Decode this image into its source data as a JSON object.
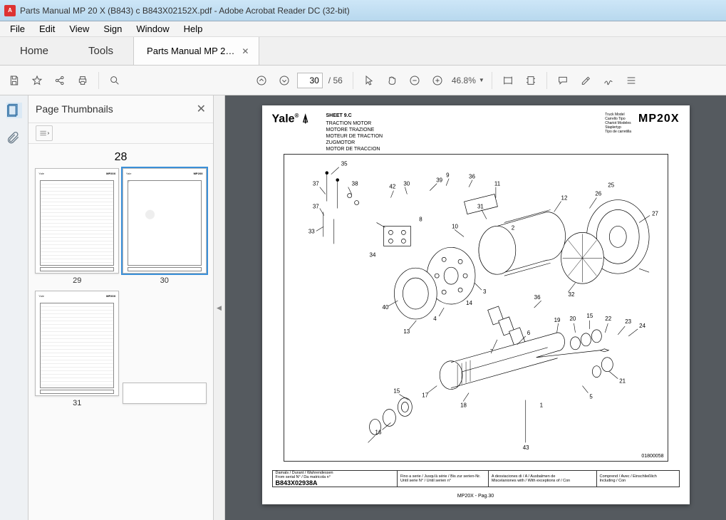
{
  "window": {
    "title": "Parts Manual MP 20 X (B843) c B843X02152X.pdf - Adobe Acrobat Reader DC (32-bit)"
  },
  "menu": {
    "file": "File",
    "edit": "Edit",
    "view": "View",
    "sign": "Sign",
    "window": "Window",
    "help": "Help"
  },
  "tabs": {
    "home": "Home",
    "tools": "Tools",
    "doc": "Parts Manual MP 2…"
  },
  "toolbar": {
    "page_current": "30",
    "page_sep": "/",
    "page_total": "56",
    "zoom": "46.8%"
  },
  "thumbnails": {
    "title": "Page Thumbnails",
    "pages": [
      "28",
      "29",
      "30",
      "31"
    ],
    "selected": "30"
  },
  "sheet": {
    "logo": "Yale",
    "sheet_no": "SHEET 9.C",
    "titles": [
      "TRACTION MOTOR",
      "MOTORE TRAZIONE",
      "MOTEUR DE TRACTION",
      "ZUGMOTOR",
      "MOTOR DE TRACCION"
    ],
    "truck_labels": [
      "Truck Model",
      "Carrello Tipo",
      "Chariot Modeles",
      "Staplertyp",
      "Tipo de carretilla"
    ],
    "model": "MP20X",
    "callouts": [
      35,
      37,
      38,
      37,
      33,
      34,
      42,
      30,
      39,
      9,
      36,
      11,
      31,
      8,
      10,
      2,
      12,
      26,
      25,
      27,
      32,
      3,
      14,
      36,
      4,
      13,
      40,
      7,
      6,
      19,
      20,
      15,
      22,
      23,
      24,
      18,
      21,
      5,
      17,
      15,
      16,
      1,
      43
    ],
    "figure_id": "01800058",
    "footer": {
      "c1a": "Damals / Durant / Wahrendessen",
      "c1b": "From serial N° / Da matricola n°",
      "serial": "B843X02938A",
      "c2a": "Fino a serie / Jusqu'à série / Bis zur serien-Nr.",
      "c2b": "Until serie N° / Until serien n°",
      "c3a": "A desviaciones di / A / Ausbalmen de",
      "c3b": "Miscelaniones with / With exceptions of / Con",
      "c4a": "Comprend / Avec / Einschließlich",
      "c4b": "Including / Con"
    },
    "page_label": "MP20X - Pag.30"
  }
}
